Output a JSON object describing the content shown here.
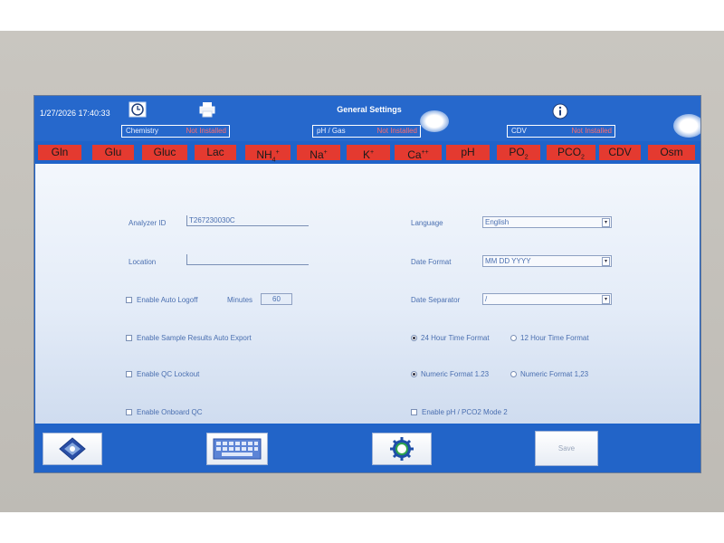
{
  "header": {
    "datetime": "1/27/2026  17:40:33",
    "title": "General Settings",
    "status": [
      {
        "label": "Chemistry",
        "value": "Not Installed"
      },
      {
        "label": "pH / Gas",
        "value": "Not Installed"
      },
      {
        "label": "CDV",
        "value": "Not Installed"
      }
    ],
    "icons": [
      "clock-icon",
      "printer-icon",
      "info-icon"
    ]
  },
  "analytes": [
    {
      "text": "Gln",
      "sub": "",
      "sup": ""
    },
    {
      "text": "Glu",
      "sub": "",
      "sup": ""
    },
    {
      "text": "Gluc",
      "sub": "",
      "sup": ""
    },
    {
      "text": "Lac",
      "sub": "",
      "sup": ""
    },
    {
      "text": "NH",
      "sub": "4",
      "sup": "+"
    },
    {
      "text": "Na",
      "sub": "",
      "sup": "+"
    },
    {
      "text": "K",
      "sub": "",
      "sup": "+"
    },
    {
      "text": "Ca",
      "sub": "",
      "sup": "++"
    },
    {
      "text": "pH",
      "sub": "",
      "sup": ""
    },
    {
      "text": "PO",
      "sub": "2",
      "sup": ""
    },
    {
      "text": "PCO",
      "sub": "2",
      "sup": ""
    },
    {
      "text": "CDV",
      "sub": "",
      "sup": ""
    },
    {
      "text": "Osm",
      "sub": "",
      "sup": ""
    }
  ],
  "form": {
    "analyzer_id_label": "Analyzer ID",
    "analyzer_id_value": "T267230030C",
    "location_label": "Location",
    "location_value": "",
    "auto_logoff_label": "Enable Auto Logoff",
    "minutes_label": "Minutes",
    "minutes_value": "60",
    "auto_export_label": "Enable Sample Results Auto Export",
    "qc_lockout_label": "Enable QC Lockout",
    "onboard_qc_label": "Enable Onboard QC",
    "language_label": "Language",
    "language_value": "English",
    "date_format_label": "Date Format",
    "date_format_value": "MM DD YYYY",
    "date_sep_label": "Date Separator",
    "date_sep_value": "/",
    "time24_label": "24 Hour Time Format",
    "time12_label": "12 Hour Time Format",
    "num_dot_label": "Numeric Format 1.23",
    "num_comma_label": "Numeric Format 1,23",
    "ph_mode_label": "Enable pH / PCO2 Mode 2"
  },
  "footer": {
    "save_label": "Save"
  },
  "colors": {
    "screen_blue": "#2668cc",
    "analyte_red": "#e43a30",
    "not_installed": "#ff6b6b"
  }
}
